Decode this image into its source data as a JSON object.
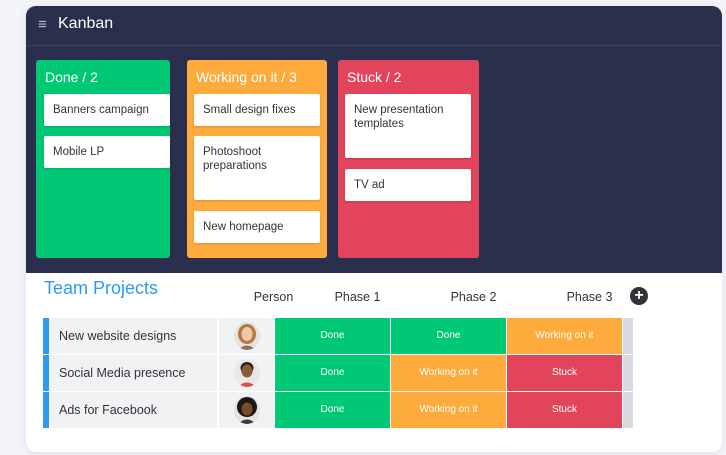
{
  "app": {
    "menu_icon": "hamburger-icon",
    "title": "Kanban"
  },
  "kanban": {
    "columns": [
      {
        "header": "Done / 2",
        "color": "#00c875",
        "cards": [
          "Banners campaign",
          "Mobile LP"
        ]
      },
      {
        "header": "Working on it / 3",
        "color": "#fdab3d",
        "cards": [
          "Small design fixes",
          "Photoshoot preparations",
          "New homepage"
        ]
      },
      {
        "header": "Stuck / 2",
        "color": "#e2445c",
        "cards": [
          "New presentation templates",
          "TV ad"
        ]
      }
    ]
  },
  "projects": {
    "title": "Team Projects",
    "headers": {
      "person": "Person",
      "phase1": "Phase 1",
      "phase2": "Phase 2",
      "phase3": "Phase 3"
    },
    "add_icon": "plus-circle-icon",
    "accent_color": "#2f9bf0",
    "rows": [
      {
        "name": "New website designs",
        "phase1": "Done",
        "phase2": "Done",
        "phase3": "Working on it"
      },
      {
        "name": "Social Media presence",
        "phase1": "Done",
        "phase2": "Working on it",
        "phase3": "Stuck"
      },
      {
        "name": "Ads for Facebook",
        "phase1": "Done",
        "phase2": "Working on it",
        "phase3": "Stuck"
      }
    ],
    "status_colors": {
      "Done": "#00c875",
      "Working on it": "#fdab3d",
      "Stuck": "#e2445c"
    }
  }
}
